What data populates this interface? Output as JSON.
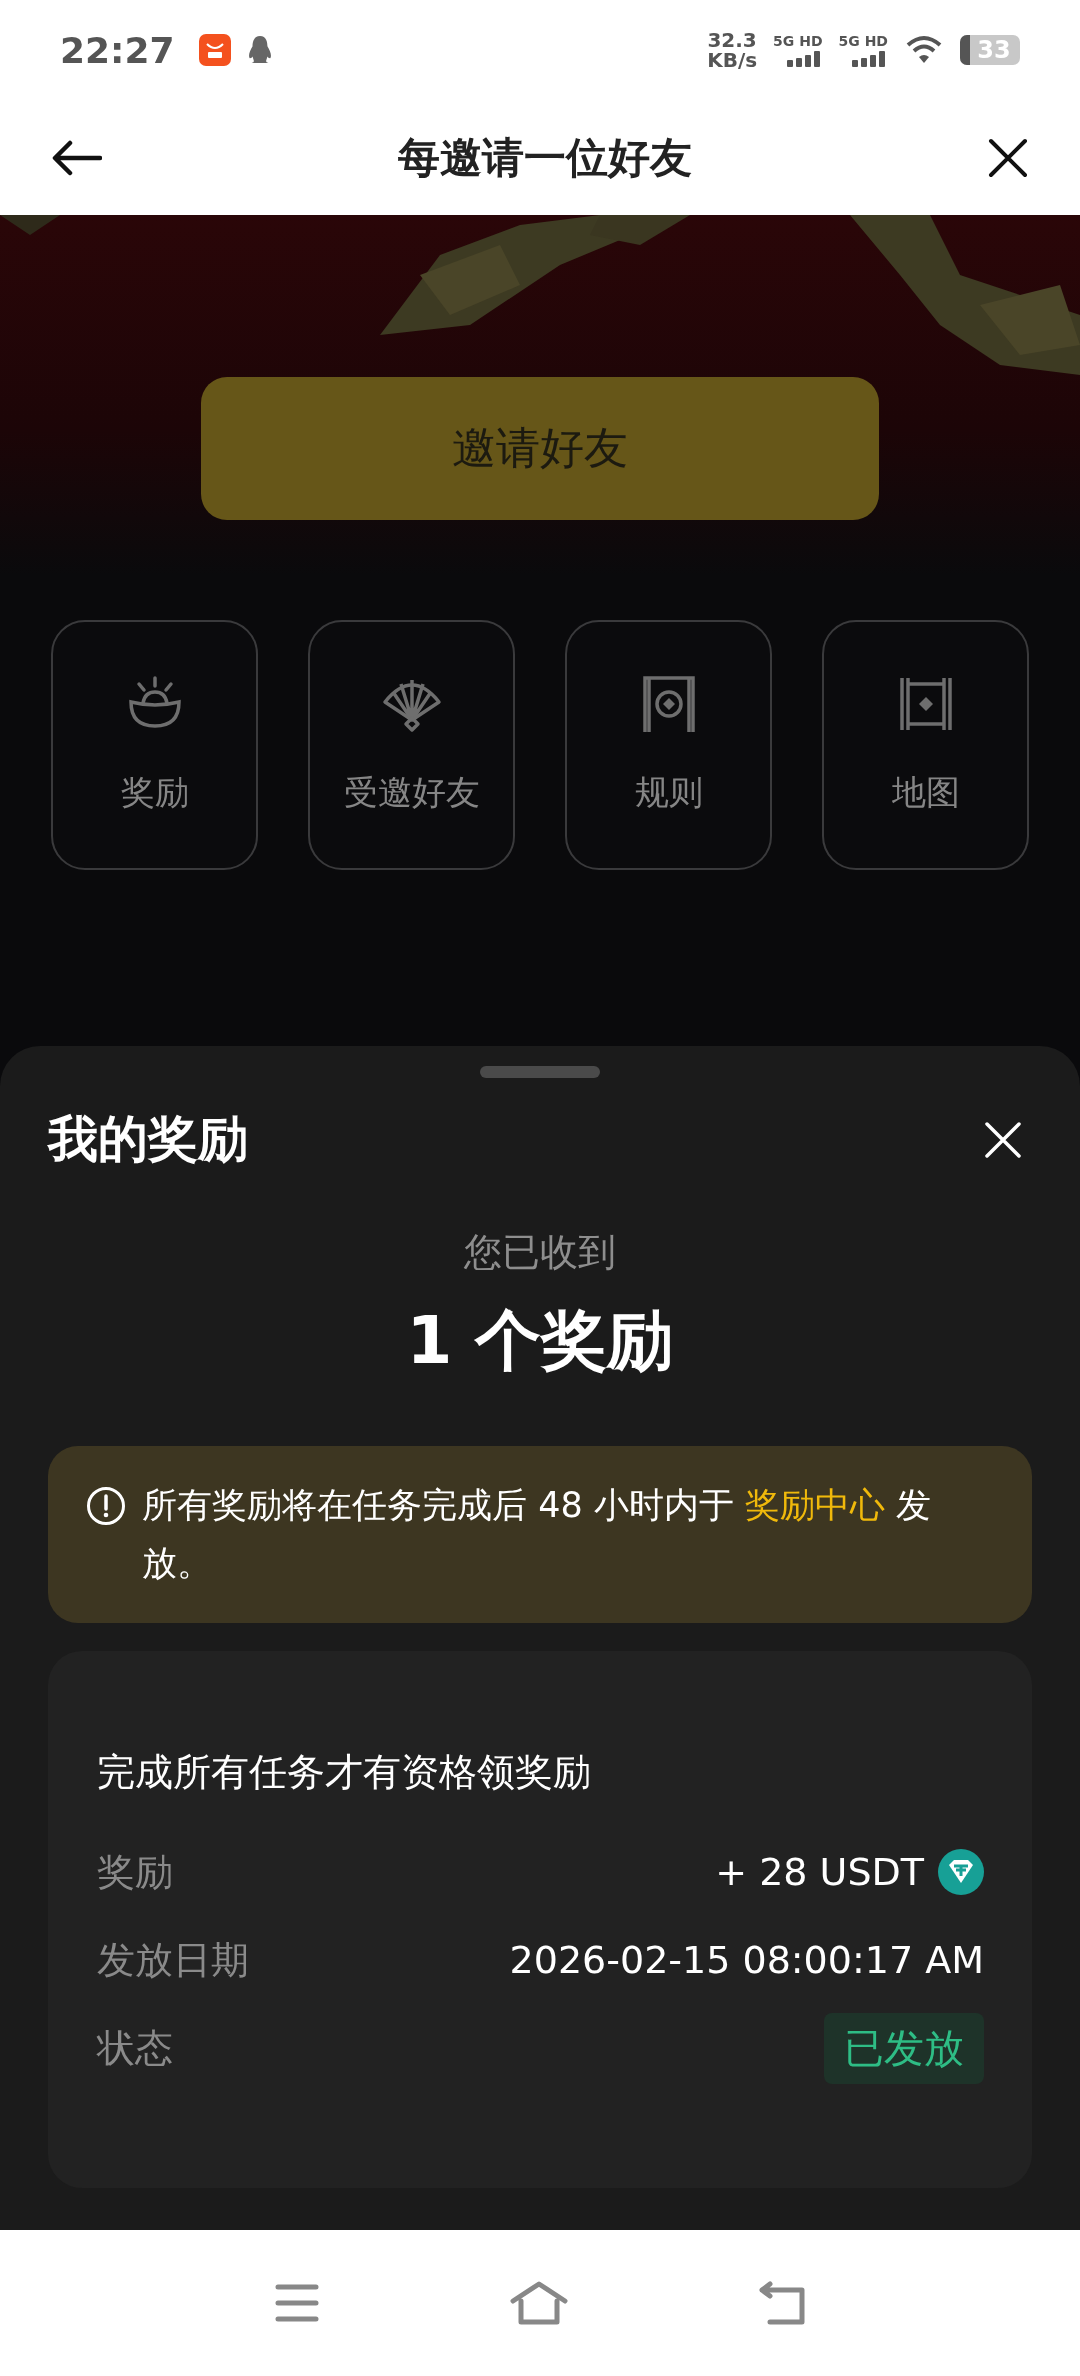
{
  "status_bar": {
    "time": "22:27",
    "net_speed": "32.3",
    "net_speed_unit": "KB/s",
    "sim_labels": [
      "5G HD",
      "5G HD"
    ],
    "battery": "33"
  },
  "header": {
    "title": "每邀请一位好友"
  },
  "invite_button": {
    "label": "邀请好友"
  },
  "shortcuts": [
    {
      "kind": "ingot",
      "label": "奖励"
    },
    {
      "kind": "fan",
      "label": "受邀好友"
    },
    {
      "kind": "gate",
      "label": "规则"
    },
    {
      "kind": "scroll",
      "label": "地图"
    }
  ],
  "sheet": {
    "title": "我的奖励",
    "received_label": "您已收到",
    "received_count": "1 个奖励",
    "notice": {
      "text_before": "所有奖励将在任务完成后 48 小时内于",
      "link": "奖励中心",
      "text_after": "发放。"
    },
    "reward_card": {
      "title": "完成所有任务才有资格领奖励",
      "rows": [
        {
          "kind": "amount",
          "label": "奖励",
          "value": "+ 28 USDT"
        },
        {
          "kind": "text",
          "label": "发放日期",
          "value": "2026-02-15 08:00:17 AM"
        },
        {
          "kind": "status",
          "label": "状态",
          "value": "已发放"
        }
      ]
    }
  }
}
